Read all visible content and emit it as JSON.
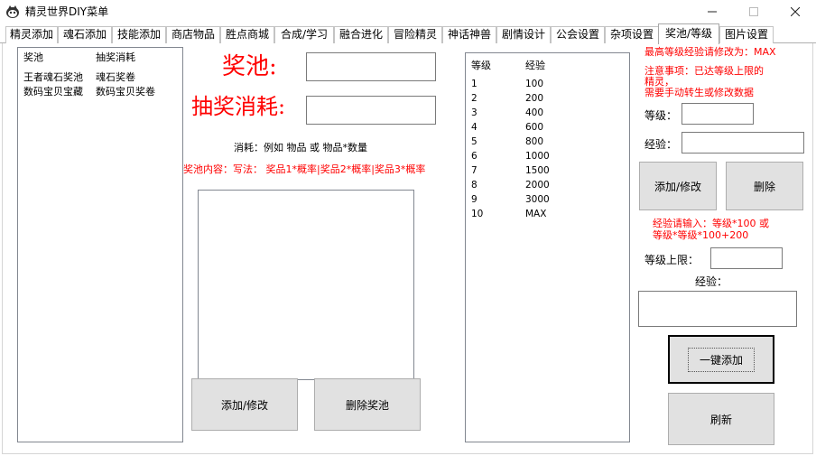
{
  "window": {
    "title": "精灵世界DIY菜单"
  },
  "tabs": [
    "精灵添加",
    "魂石添加",
    "技能添加",
    "商店物品",
    "胜点商城",
    "合成/学习",
    "融合进化",
    "冒险精灵",
    "神话神兽",
    "剧情设计",
    "公会设置",
    "杂项设置",
    "奖池/等级",
    "图片设置"
  ],
  "pool": {
    "columns": [
      "奖池",
      "抽奖消耗"
    ],
    "rows": [
      [
        "王者魂石奖池",
        "魂石奖卷"
      ],
      [
        "数码宝贝宝藏",
        "数码宝贝奖卷"
      ]
    ],
    "pool_label": "奖池:",
    "cost_label": "抽奖消耗:",
    "pool_value": "",
    "cost_value": "",
    "cost_hint": "消耗：例如 物品 或 物品*数量",
    "content_hint": "奖池内容：写法： 奖品1*概率|奖品2*概率|奖品3*概率",
    "content_value": "",
    "add_button": "添加/修改",
    "delete_button": "删除奖池"
  },
  "levels": {
    "columns": [
      "等级",
      "经验"
    ],
    "rows": [
      [
        "1",
        "100"
      ],
      [
        "2",
        "200"
      ],
      [
        "3",
        "400"
      ],
      [
        "4",
        "600"
      ],
      [
        "5",
        "800"
      ],
      [
        "6",
        "1000"
      ],
      [
        "7",
        "1500"
      ],
      [
        "8",
        "2000"
      ],
      [
        "9",
        "3000"
      ],
      [
        "10",
        "MAX"
      ]
    ],
    "max_note": "最高等级经验请修改为：MAX",
    "notice_line1": "注意事项：已达等级上限的",
    "notice_line2": "精灵，",
    "notice_line3": "需要手动转生或修改数据",
    "level_label": "等级：",
    "exp_label": "经验：",
    "level_value": "",
    "exp_value": "",
    "add_button": "添加/修改",
    "delete_button": "删除",
    "formula_hint_line1": "经验请输入：等级*100   或",
    "formula_hint_line2": "等级*等级*100+200",
    "cap_label": "等级上限：",
    "cap_value": "",
    "exp_label2": "经验：",
    "exp_value2": "",
    "bulk_add_button": "一键添加",
    "refresh_button": "刷新"
  },
  "colors": {
    "accent_red": "#ff0000",
    "button_face": "#e1e1e1"
  }
}
